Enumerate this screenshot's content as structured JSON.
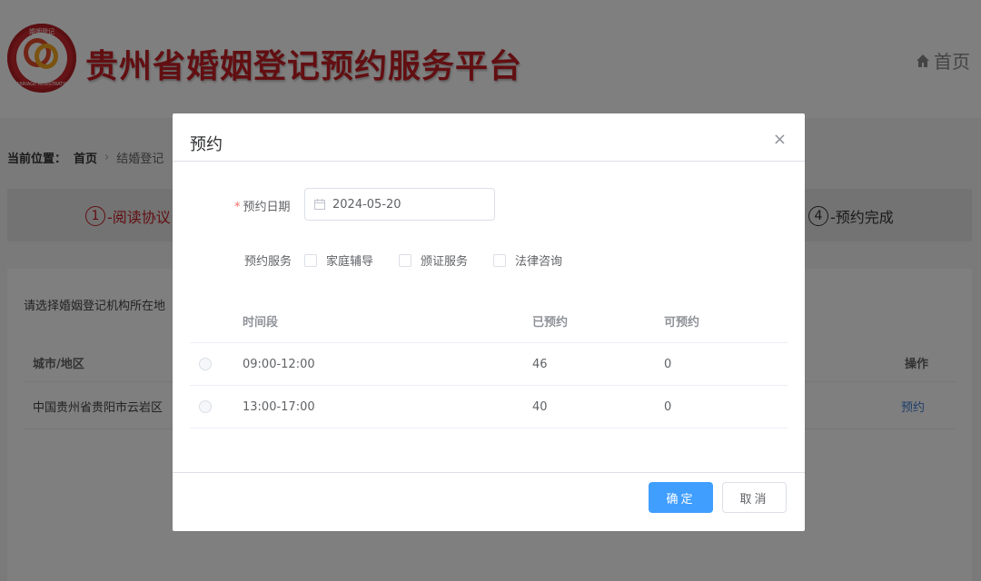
{
  "header": {
    "logo_ring_top": "婚姻登记",
    "logo_ring_bottom": "MARRIAGE REGISTRATION",
    "site_title": "贵州省婚姻登记预约服务平台",
    "home_label": "首页"
  },
  "breadcrumb": {
    "label": "当前位置：",
    "home": "首页",
    "current": "结婚登记"
  },
  "steps": [
    {
      "num": "1",
      "label": "-阅读协议"
    },
    {
      "num": "4",
      "label": "-预约完成"
    }
  ],
  "panel": {
    "hint": "请选择婚姻登记机构所在地",
    "col_city": "城市/地区",
    "col_action": "操作",
    "row_city": "中国贵州省贵阳市云岩区",
    "row_action": "预约"
  },
  "dialog": {
    "title": "预约",
    "close_glyph": "×",
    "date_label": "预约日期",
    "required_mark": "*",
    "date_value": "2024-05-20",
    "service_label": "预约服务",
    "services": [
      {
        "label": "家庭辅导",
        "checked": false
      },
      {
        "label": "颁证服务",
        "checked": false
      },
      {
        "label": "法律咨询",
        "checked": false
      }
    ],
    "table_headers": {
      "time": "时间段",
      "booked": "已预约",
      "available": "可预约"
    },
    "slots": [
      {
        "time": "09:00-12:00",
        "booked": "46",
        "available": "0"
      },
      {
        "time": "13:00-17:00",
        "booked": "40",
        "available": "0"
      }
    ],
    "ok_label": "确定",
    "cancel_label": "取消"
  },
  "colors": {
    "brand_red": "#c41e24",
    "primary_blue": "#409eff",
    "link_blue": "#3a7bd5"
  },
  "icons": [
    "home-icon",
    "close-icon",
    "calendar-icon"
  ]
}
